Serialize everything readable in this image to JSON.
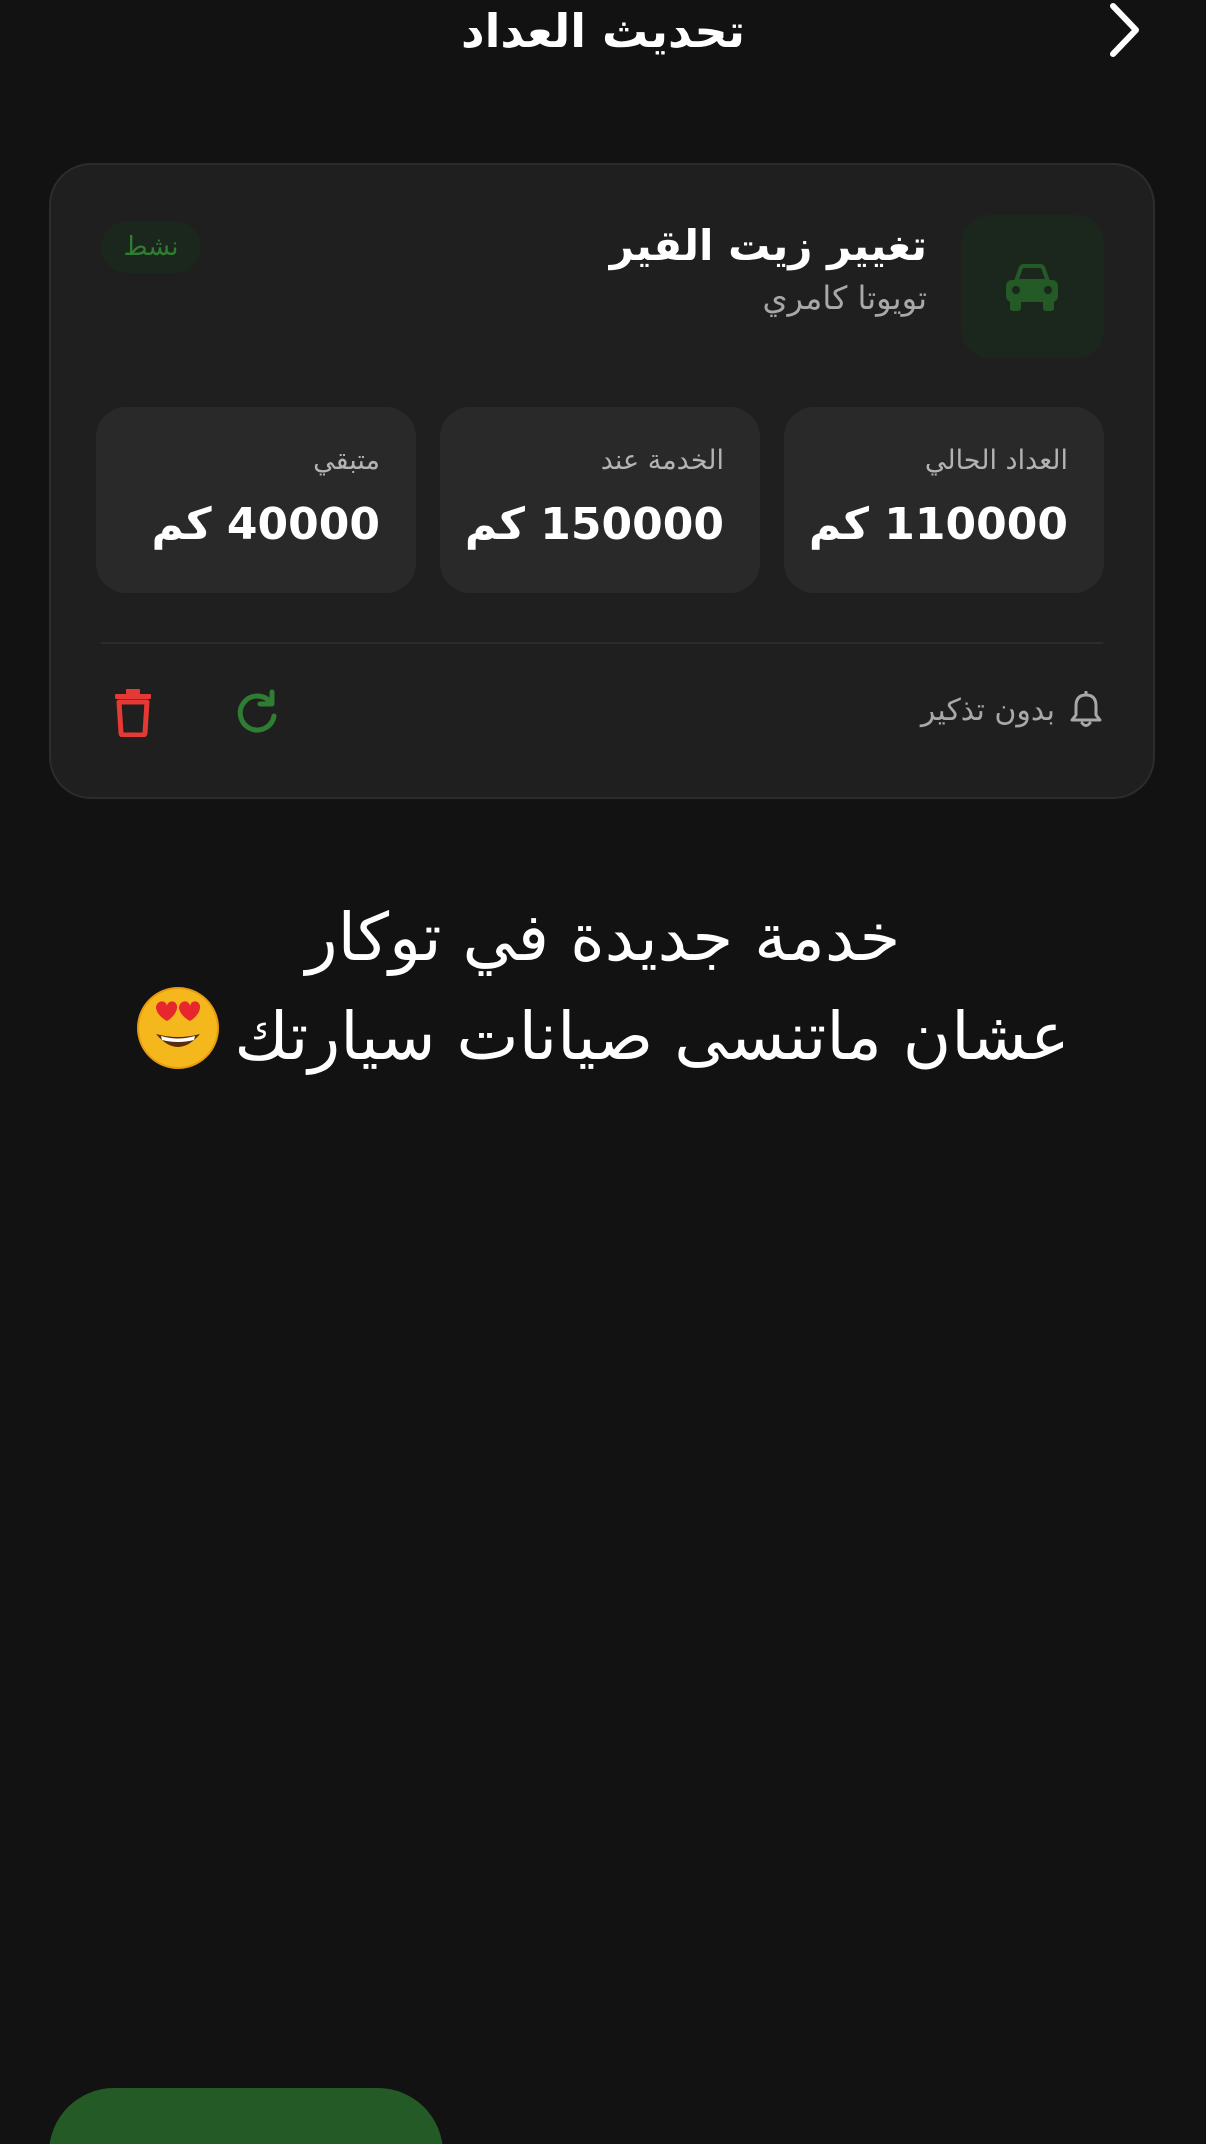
{
  "header": {
    "title": "تحديث العداد",
    "back_icon": "chevron-right-icon"
  },
  "service_card": {
    "icon": "car-icon",
    "title": "تغيير زيت القير",
    "vehicle": "تويوتا كامري",
    "status": "نشط",
    "stats": [
      {
        "label": "العداد الحالي",
        "value": "110000 كم"
      },
      {
        "label": "الخدمة عند",
        "value": "150000 كم"
      },
      {
        "label": "متبقي",
        "value": "40000 كم"
      }
    ],
    "reminder_label": "بدون تذكير",
    "reminder_icon": "bell-icon",
    "actions": {
      "refresh_icon": "refresh-icon",
      "delete_icon": "trash-icon"
    }
  },
  "promo": {
    "line1": "خدمة جديدة في توكار",
    "line2": "عشان ماتنسى صيانات سيارتك",
    "emoji": "heart-eyes-emoji"
  },
  "colors": {
    "background": "#121212",
    "card": "#1f1f1f",
    "stat_tile": "#292929",
    "accent_green": "#2e7d32",
    "delete_red": "#e53935",
    "fab_green": "#245a26"
  }
}
